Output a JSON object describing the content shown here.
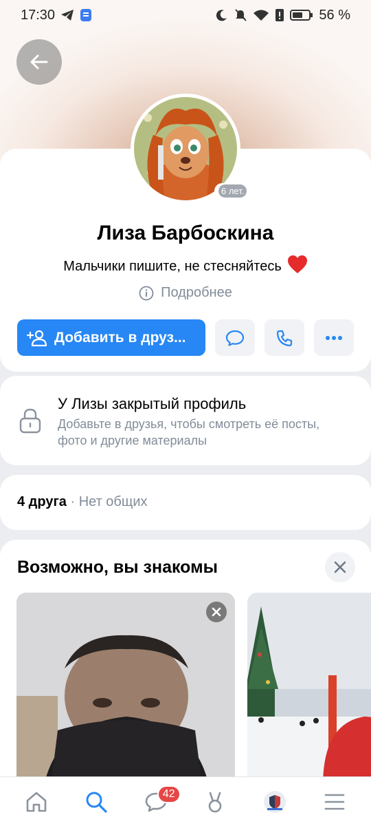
{
  "status_bar": {
    "time": "17:30",
    "battery": "56 %"
  },
  "profile": {
    "name": "Лиза Барбоскина",
    "age_badge": "6 лет.",
    "status": "Мальчики пишите, не стесняйтесь",
    "status_emoji": "❤️",
    "more_info": "Подробнее",
    "add_friend_label": "Добавить в друз..."
  },
  "private_profile": {
    "title": "У Лизы закрытый профиль",
    "description": "Добавьте в друзья, чтобы смотреть её посты, фото и другие материалы"
  },
  "friends": {
    "count_label": "4 друга",
    "separator": " · ",
    "mutual_label": "Нет общих"
  },
  "suggestions": {
    "title": "Возможно, вы знакомы"
  },
  "nav": {
    "messages_badge": "42"
  },
  "colors": {
    "accent": "#2787f5",
    "badge": "#e64646",
    "muted": "#818c99"
  },
  "icons": [
    "back-arrow-icon",
    "add-user-icon",
    "message-icon",
    "phone-icon",
    "more-icon",
    "info-icon",
    "lock-icon",
    "close-icon",
    "home-icon",
    "search-icon",
    "chat-icon",
    "clips-icon",
    "menu-icon"
  ]
}
